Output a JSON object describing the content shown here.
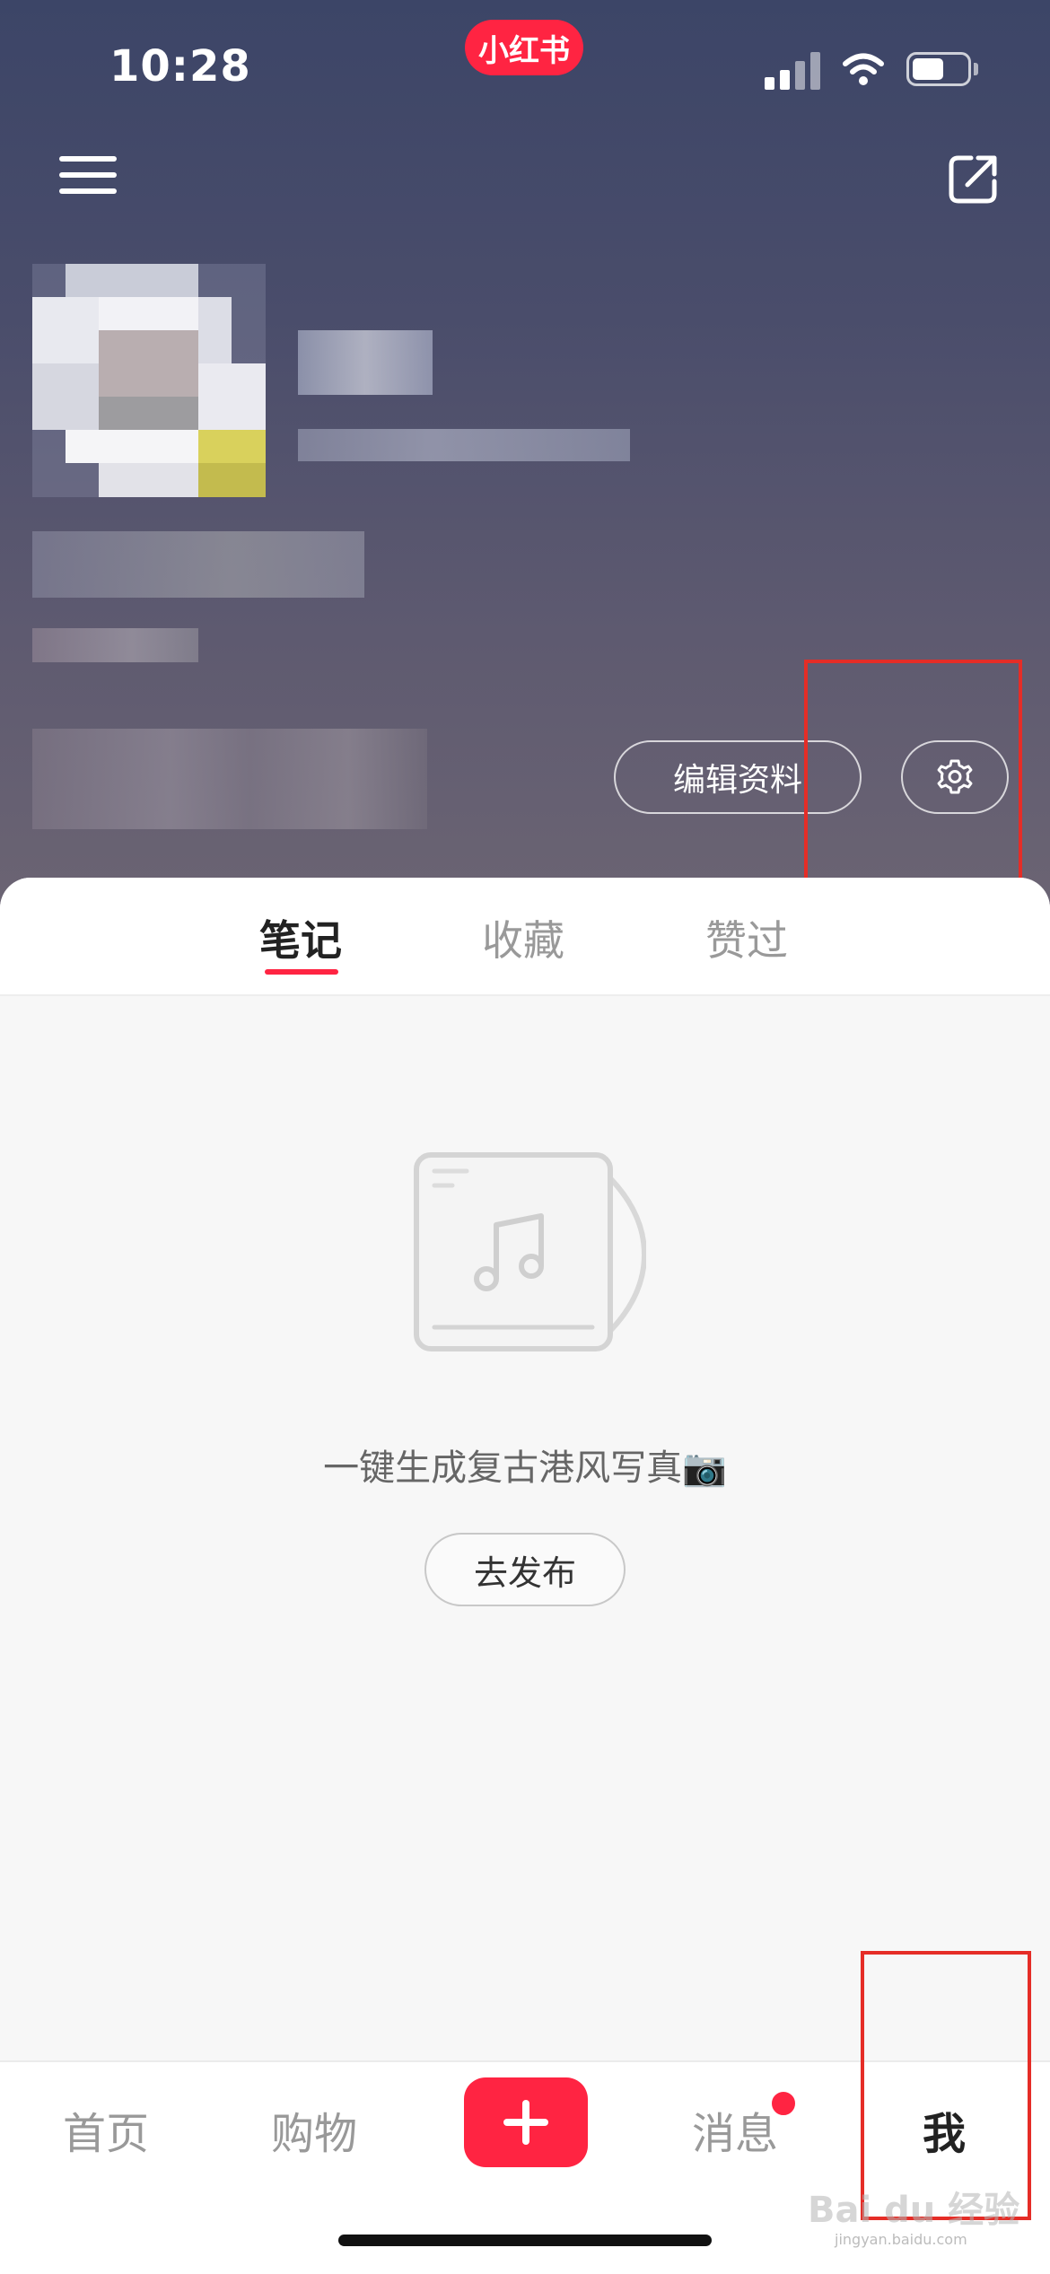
{
  "status_bar": {
    "time": "10:28",
    "app_badge": "小红书"
  },
  "profile": {
    "edit_label": "编辑资料"
  },
  "tabs": [
    {
      "label": "笔记",
      "active": true
    },
    {
      "label": "收藏",
      "active": false
    },
    {
      "label": "赞过",
      "active": false
    }
  ],
  "empty_state": {
    "prompt": "一键生成复古港风写真📷",
    "publish_label": "去发布"
  },
  "bottom_nav": {
    "home": "首页",
    "shop": "购物",
    "messages": "消息",
    "me": "我"
  },
  "watermark": {
    "text": "Bai du 经验",
    "sub": "jingyan.baidu.com"
  },
  "colors": {
    "brand": "#ff2442",
    "annotation": "#e52d27"
  },
  "icons": [
    "menu-icon",
    "share-icon",
    "settings-gear-icon",
    "music-note-icon",
    "plus-icon"
  ]
}
